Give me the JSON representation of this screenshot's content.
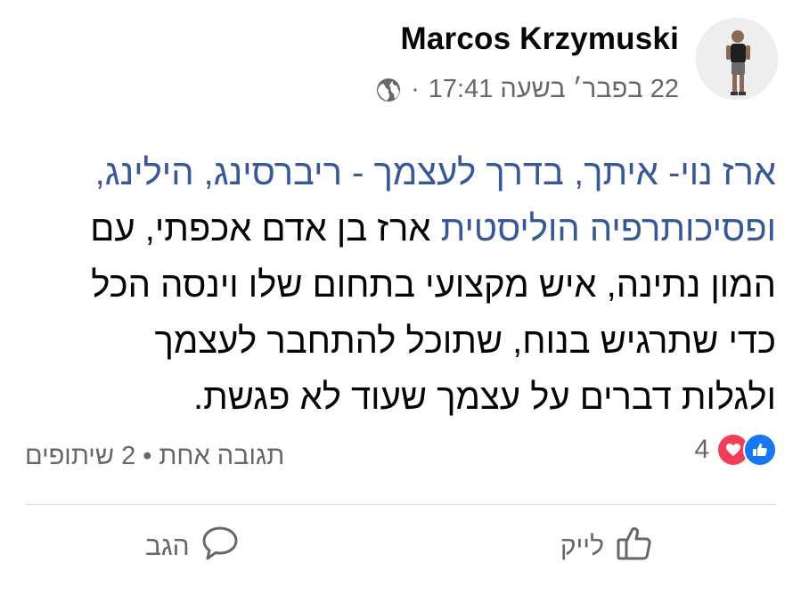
{
  "post": {
    "author": "Marcos Krzymuski",
    "timestamp": "22 בפבר׳ בשעה 17:41",
    "separator": "·",
    "privacy_icon": "globe-icon",
    "text_lines": [
      {
        "link": "ארז נוי- איתך, בדרך לעצמך - ריברסינג, הילינג,",
        "text": ""
      },
      {
        "link": "ופסיכותרפיה הוליסטית",
        "text": " ארז בן אדם אכפתי, עם"
      },
      {
        "link": "",
        "text": "המון נתינה, איש מקצועי בתחום שלו וינסה הכל"
      },
      {
        "link": "",
        "text": "כדי שתרגיש בנוח, שתוכל להתחבר לעצמך"
      },
      {
        "link": "",
        "text": "ולגלות דברים על עצמך שעוד לא פגשת."
      }
    ]
  },
  "reactions": {
    "count": "4",
    "icons": [
      "like-icon",
      "love-icon"
    ]
  },
  "stats": {
    "comments": "תגובה אחת",
    "dot": "•",
    "shares": "2 שיתופים"
  },
  "actions": {
    "like_label": "לייק",
    "comment_label": "הגב"
  },
  "colors": {
    "link": "#385898",
    "like_blue": "#1877f2",
    "love_red": "#f33e58",
    "secondary_text": "#65676b"
  }
}
